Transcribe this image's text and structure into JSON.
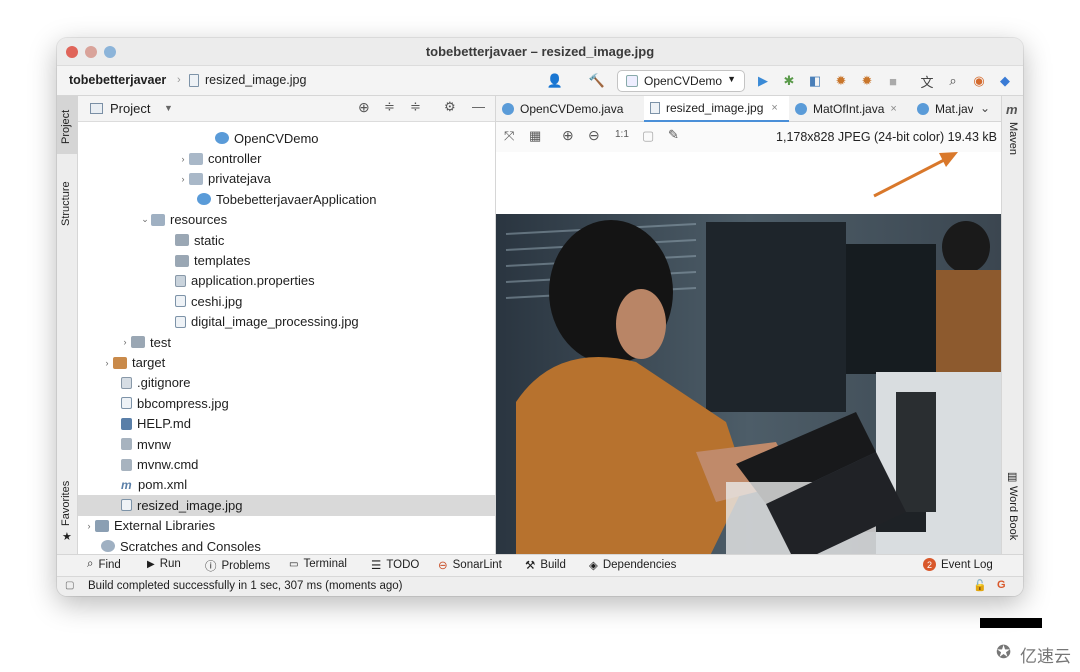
{
  "window": {
    "title": "tobebetterjavaer – resized_image.jpg"
  },
  "navbar": {
    "project": "tobebetterjavaer",
    "file": "resized_image.jpg",
    "run_config": "OpenCVDemo"
  },
  "project_panel": {
    "title": "Project"
  },
  "tree": [
    {
      "label": "OpenCVDemo",
      "icon": "java-class-icon"
    },
    {
      "label": "controller",
      "icon": "package-icon"
    },
    {
      "label": "privatejava",
      "icon": "package-icon"
    },
    {
      "label": "TobebetterjavaerApplication",
      "icon": "java-class-icon"
    },
    {
      "label": "resources",
      "icon": "resources-folder-icon"
    },
    {
      "label": "static",
      "icon": "folder-icon"
    },
    {
      "label": "templates",
      "icon": "folder-icon"
    },
    {
      "label": "application.properties",
      "icon": "properties-file-icon"
    },
    {
      "label": "ceshi.jpg",
      "icon": "image-file-icon"
    },
    {
      "label": "digital_image_processing.jpg",
      "icon": "image-file-icon"
    },
    {
      "label": "test",
      "icon": "folder-icon"
    },
    {
      "label": "target",
      "icon": "excluded-folder-icon"
    },
    {
      "label": ".gitignore",
      "icon": "gitignore-file-icon"
    },
    {
      "label": "bbcompress.jpg",
      "icon": "image-file-icon"
    },
    {
      "label": "HELP.md",
      "icon": "markdown-file-icon"
    },
    {
      "label": "mvnw",
      "icon": "script-file-icon"
    },
    {
      "label": "mvnw.cmd",
      "icon": "script-file-icon"
    },
    {
      "label": "pom.xml",
      "icon": "maven-file-icon"
    },
    {
      "label": "resized_image.jpg",
      "icon": "image-file-icon"
    },
    {
      "label": "External Libraries",
      "icon": "library-icon"
    },
    {
      "label": "Scratches and Consoles",
      "icon": "scratches-icon"
    }
  ],
  "tabs": [
    {
      "label": "OpenCVDemo.java"
    },
    {
      "label": "resized_image.jpg"
    },
    {
      "label": "MatOfInt.java"
    },
    {
      "label": "Mat.jav"
    }
  ],
  "image_info": "1,178x828 JPEG (24-bit color) 19.43 kB",
  "side_left": {
    "project": "Project",
    "structure": "Structure",
    "favorites": "Favorites"
  },
  "side_right": {
    "maven": "Maven",
    "word_book": "Word Book"
  },
  "bottom_tools": {
    "find": "Find",
    "run": "Run",
    "problems": "Problems",
    "terminal": "Terminal",
    "todo": "TODO",
    "sonarlint": "SonarLint",
    "build": "Build",
    "dependencies": "Dependencies",
    "event_log": "Event Log",
    "event_count": "2"
  },
  "status": "Build completed successfully in 1 sec, 307 ms (moments ago)",
  "watermark": "亿速云",
  "colors": {
    "accent": "#4a8fd8",
    "arrow": "#d9782b",
    "selection": "#d9d9d9"
  }
}
